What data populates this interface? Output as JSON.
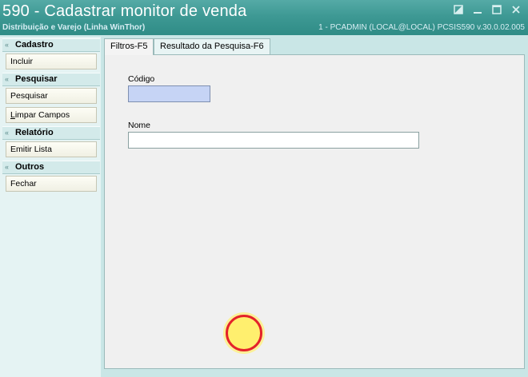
{
  "window": {
    "title": "590 - Cadastrar monitor de venda",
    "subtitle": "Distribuição e Varejo (Linha WinThor)",
    "status": "1 - PCADMIN (LOCAL@LOCAL)   PCSIS590  v.30.0.02.005"
  },
  "sidebar": {
    "groups": [
      {
        "label": "Cadastro",
        "items": [
          {
            "label": "Incluir"
          }
        ]
      },
      {
        "label": "Pesquisar",
        "items": [
          {
            "label": "Pesquisar"
          },
          {
            "label_first": "L",
            "label_rest": "impar Campos"
          }
        ]
      },
      {
        "label": "Relatório",
        "items": [
          {
            "label": "Emitir Lista"
          }
        ]
      },
      {
        "label": "Outros",
        "items": [
          {
            "label": "Fechar"
          }
        ]
      }
    ]
  },
  "tabs": [
    {
      "label": "Filtros-F5",
      "active": true
    },
    {
      "label": "Resultado da Pesquisa-F6",
      "active": false
    }
  ],
  "form": {
    "codigo": {
      "label": "Código",
      "value": ""
    },
    "nome": {
      "label": "Nome",
      "value": ""
    }
  },
  "colors": {
    "titlebar": "#3e9994",
    "codigo_field": "#c6d4f5",
    "cursor_fill": "#ffef6e",
    "cursor_ring": "#e4222a"
  }
}
